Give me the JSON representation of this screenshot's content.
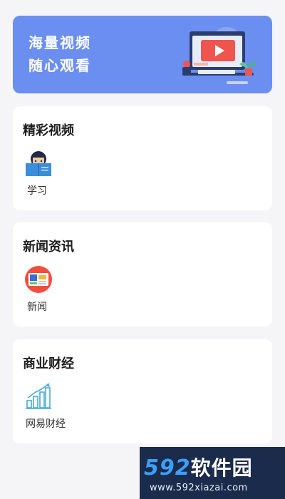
{
  "banner": {
    "line1": "海量视频",
    "line2": "随心观看"
  },
  "sections": [
    {
      "title": "精彩视频",
      "item": {
        "label": "学习",
        "icon": "study-book-icon"
      }
    },
    {
      "title": "新闻资讯",
      "item": {
        "label": "新闻",
        "icon": "news-icon"
      }
    },
    {
      "title": "商业财经",
      "item": {
        "label": "网易财经",
        "icon": "finance-chart-icon"
      }
    }
  ],
  "watermark": {
    "logo_num": "592",
    "logo_cn": "软件园",
    "url": "www.592xiazai.com"
  },
  "colors": {
    "banner_bg": "#6b8ff0",
    "page_bg": "#f5f5f7",
    "card_bg": "#ffffff"
  }
}
